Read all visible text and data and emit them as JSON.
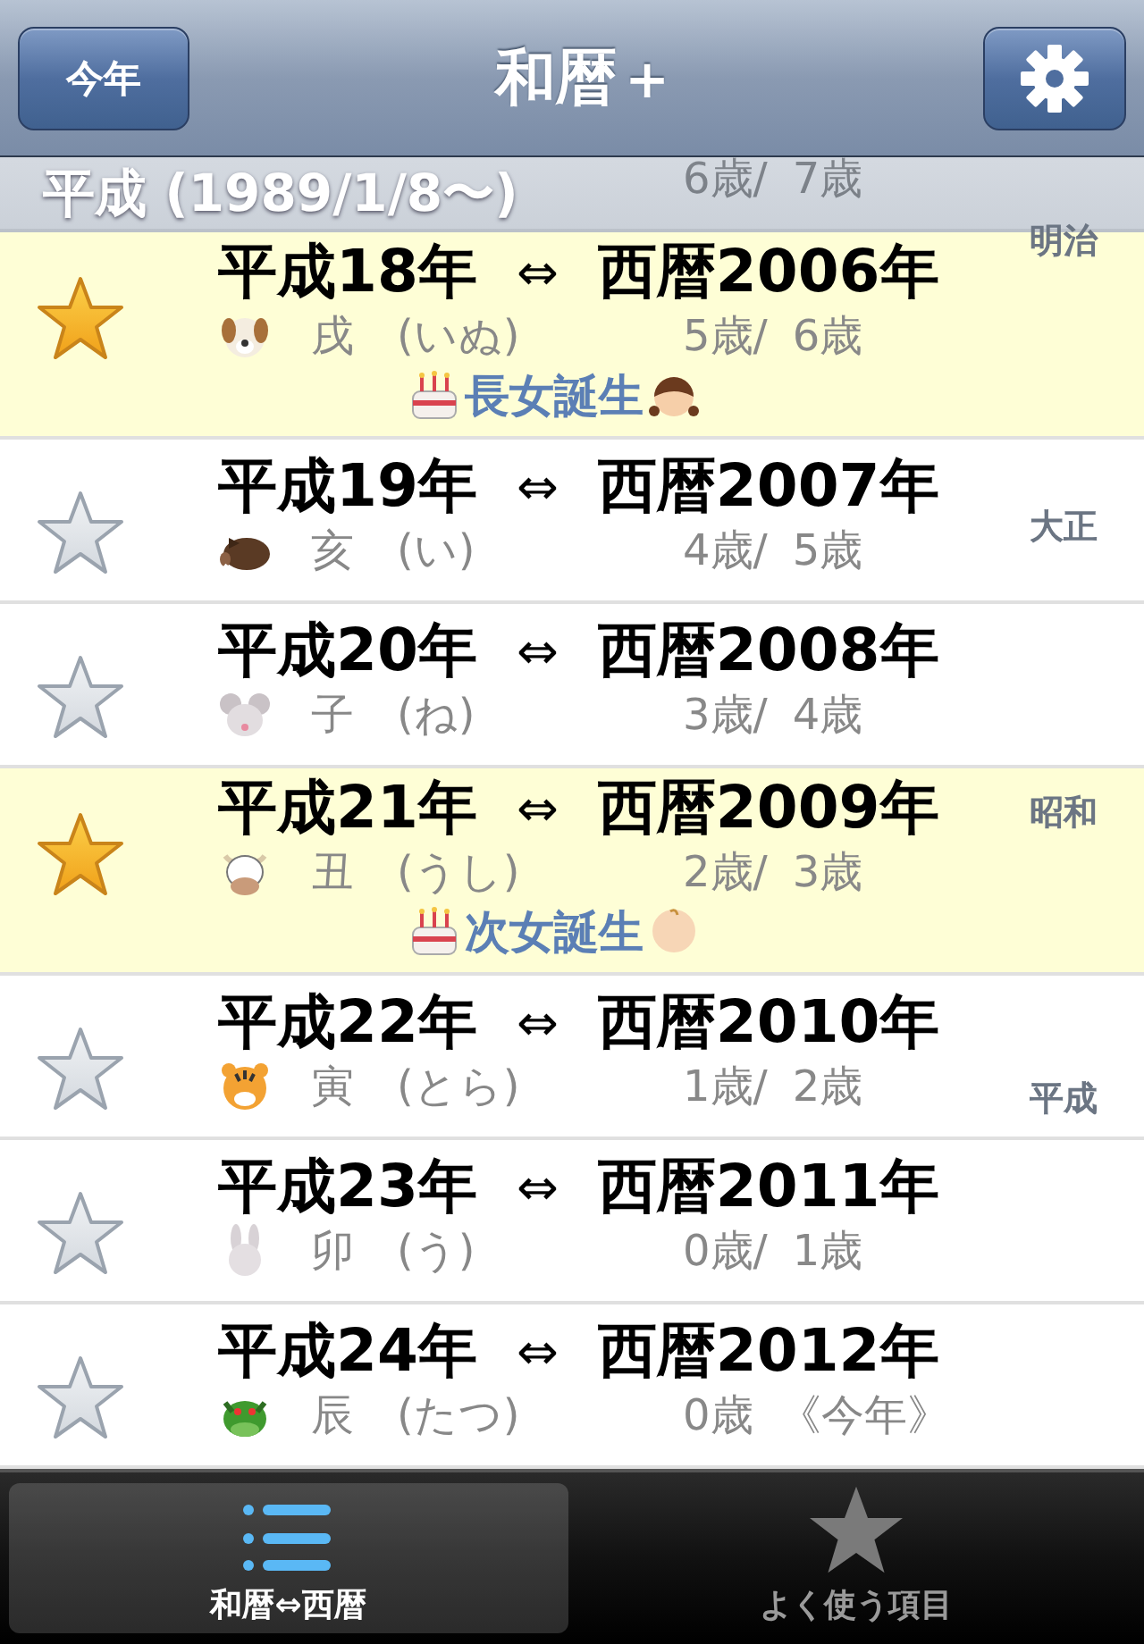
{
  "nav_bar": {
    "left_button": "今年",
    "title": "和暦＋"
  },
  "section_header": {
    "title": "平成 (1989/1/8〜)"
  },
  "partial_row": {
    "age_1": "6歳/",
    "age_2": "7歳"
  },
  "rows": [
    {
      "era_year": "平成18年",
      "arrow": "⇔",
      "western_year": "西暦2006年",
      "zodiac": "戌",
      "reading": "(いぬ)",
      "age_1": "5歳/",
      "age_2": "6歳",
      "favorite": true,
      "event": "長女誕生"
    },
    {
      "era_year": "平成19年",
      "arrow": "⇔",
      "western_year": "西暦2007年",
      "zodiac": "亥",
      "reading": "(い)",
      "age_1": "4歳/",
      "age_2": "5歳",
      "favorite": false
    },
    {
      "era_year": "平成20年",
      "arrow": "⇔",
      "western_year": "西暦2008年",
      "zodiac": "子",
      "reading": "(ね)",
      "age_1": "3歳/",
      "age_2": "4歳",
      "favorite": false
    },
    {
      "era_year": "平成21年",
      "arrow": "⇔",
      "western_year": "西暦2009年",
      "zodiac": "丑",
      "reading": "(うし)",
      "age_1": "2歳/",
      "age_2": "3歳",
      "favorite": true,
      "event": "次女誕生"
    },
    {
      "era_year": "平成22年",
      "arrow": "⇔",
      "western_year": "西暦2010年",
      "zodiac": "寅",
      "reading": "(とら)",
      "age_1": "1歳/",
      "age_2": "2歳",
      "favorite": false
    },
    {
      "era_year": "平成23年",
      "arrow": "⇔",
      "western_year": "西暦2011年",
      "zodiac": "卯",
      "reading": "(う)",
      "age_1": "0歳/",
      "age_2": "1歳",
      "favorite": false
    },
    {
      "era_year": "平成24年",
      "arrow": "⇔",
      "western_year": "西暦2012年",
      "zodiac": "辰",
      "reading": "(たつ)",
      "age_1": "0歳",
      "age_2": "《今年》",
      "favorite": false
    }
  ],
  "section_index": [
    "明治",
    "大正",
    "昭和",
    "平成"
  ],
  "tabs": [
    {
      "label": "和暦⇔西暦",
      "selected": true
    },
    {
      "label": "よく使う項目",
      "selected": false
    }
  ]
}
